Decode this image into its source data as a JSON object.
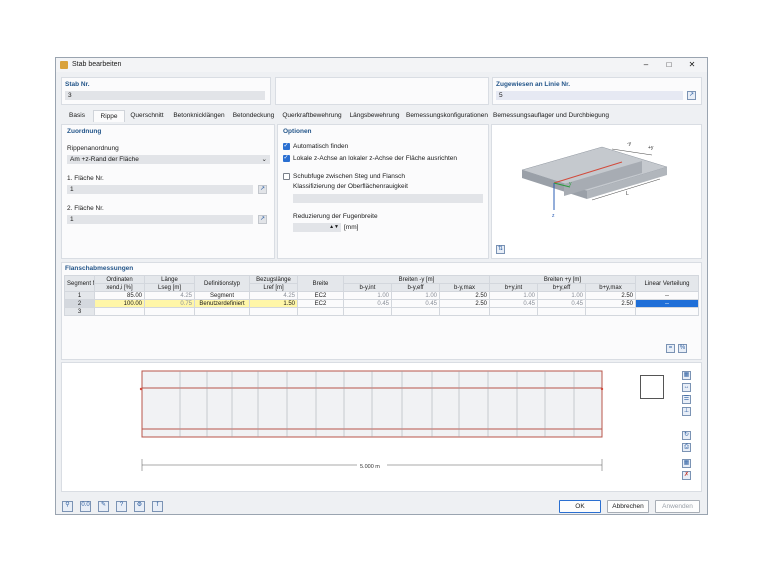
{
  "window": {
    "title": "Stab bearbeiten"
  },
  "top": {
    "stab_label": "Stab Nr.",
    "stab_value": "3",
    "zugewiesen_label": "Zugewiesen an Linie Nr.",
    "zugewiesen_value": "5"
  },
  "tabs": [
    "Basis",
    "Rippe",
    "Querschnitt",
    "Betonknicklängen",
    "Betondeckung",
    "Querkraftbewehrung",
    "Längsbewehrung",
    "Bemessungskonfigurationen",
    "Bemessungsauflager und Durchbiegung"
  ],
  "zuordnung": {
    "header": "Zuordnung",
    "rippen_label": "Rippenanordnung",
    "rippen_value": "Am +z-Rand der Fläche",
    "flaeche1_label": "1. Fläche Nr.",
    "flaeche1_value": "1",
    "flaeche2_label": "2. Fläche Nr.",
    "flaeche2_value": "1"
  },
  "optionen": {
    "header": "Optionen",
    "opt1": "Automatisch finden",
    "opt2": "Lokale z-Achse an lokaler z-Achse der Fläche ausrichten",
    "opt3": "Schubfuge zwischen Steg und Flansch",
    "klass_label": "Klassifizierung der Oberflächenrauigkeit",
    "reduz_label": "Reduzierung der Fugenbreite",
    "reduz_unit": "[mm]"
  },
  "axes3d": {
    "y": "y",
    "plusy": "+y",
    "minusy": "-y",
    "z": "z",
    "L": "L"
  },
  "flansch": {
    "header": "Flanschabmessungen",
    "columns": {
      "seg": "Segment Nummer",
      "ord": "Ordinaten",
      "ord_sub": "xend,i [%]",
      "laenge": "Länge",
      "laenge_sub": "Lseg [m]",
      "def": "Definitionstyp",
      "bezug": "Bezugslänge",
      "bezug_sub": "Lref [m]",
      "breite": "Breite",
      "bminus": "Breiten -y [m]",
      "bplus": "Breiten +y [m]",
      "bint": "b-y,int",
      "beff": "b-y,eff",
      "bmax": "b-y,max",
      "bpint": "b+y,int",
      "bpeff": "b+y,eff",
      "bpmax": "b+y,max",
      "lin": "Linear Verteilung"
    },
    "rows": [
      {
        "seg": "1",
        "ord": "85.00",
        "len": "4.25",
        "def": "Segment",
        "ref": "4.25",
        "breite": "EC2",
        "a": "1.00",
        "b": "1.00",
        "c": "2.50",
        "d": "1.00",
        "e": "1.00",
        "f": "2.50",
        "g": "--"
      },
      {
        "seg": "2",
        "ord": "100.00",
        "len": "0.75",
        "def": "Benutzerdefiniert",
        "ref": "1.50",
        "breite": "EC2",
        "a": "0.45",
        "b": "0.45",
        "c": "2.50",
        "d": "0.45",
        "e": "0.45",
        "f": "2.50",
        "g": "--"
      },
      {
        "seg": "3",
        "ord": "",
        "len": "",
        "def": "",
        "ref": "",
        "breite": "",
        "a": "",
        "b": "",
        "c": "",
        "d": "",
        "e": "",
        "f": "",
        "g": ""
      }
    ]
  },
  "dimension": "5.000 m",
  "buttons": {
    "ok": "OK",
    "abbrechen": "Abbrechen",
    "anwenden": "Anwenden"
  },
  "colors": {
    "accent": "#1f6fd8",
    "header_text": "#24568a",
    "highlight": "#fff6a8",
    "beam": "#b8544a"
  }
}
